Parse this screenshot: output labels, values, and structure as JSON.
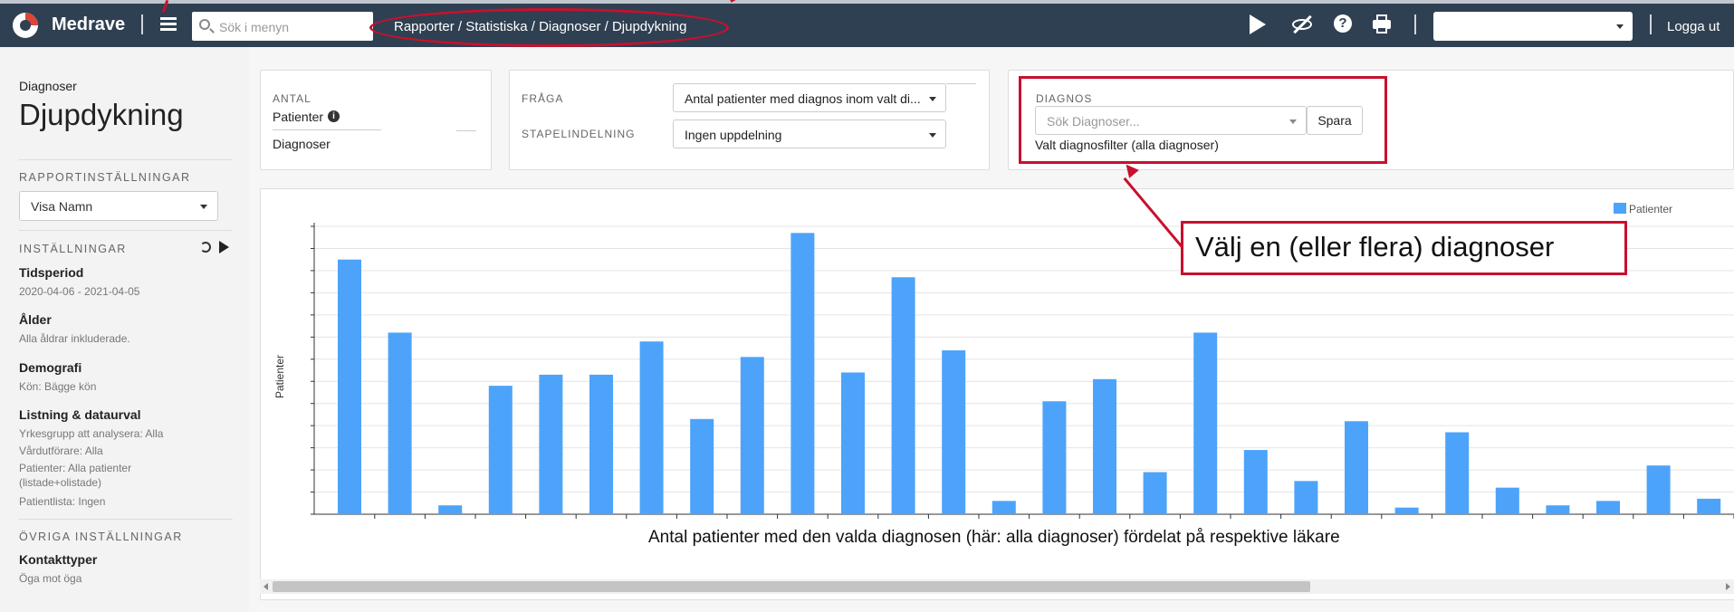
{
  "app": {
    "name": "Medrave"
  },
  "topbar": {
    "search_placeholder": "Sök i menyn",
    "breadcrumb": "Rapporter / Statistiska / Diagnoser / Djupdykning",
    "logout_label": "Logga ut",
    "user_select_value": "",
    "icons": [
      "play-icon",
      "eye-off-icon",
      "help-icon",
      "print-icon"
    ]
  },
  "sidebar": {
    "category": "Diagnoser",
    "title": "Djupdykning",
    "report_settings_heading": "RAPPORTINSTÄLLNINGAR",
    "display_select": "Visa Namn",
    "settings_heading": "INSTÄLLNINGAR",
    "settings": [
      {
        "label": "Tidsperiod",
        "lines": [
          "2020-04-06 - 2021-04-05"
        ]
      },
      {
        "label": "Ålder",
        "lines": [
          "Alla åldrar inkluderade."
        ]
      },
      {
        "label": "Demografi",
        "lines": [
          "Kön: Bägge kön"
        ]
      },
      {
        "label": "Listning & dataurval",
        "lines": [
          "Yrkesgrupp att analysera: Alla",
          "Vårdutförare: Alla",
          "Patienter: Alla patienter",
          "(listade+olistade)",
          "Patientlista: Ingen"
        ]
      }
    ],
    "other_heading": "ÖVRIGA INSTÄLLNINGAR",
    "other": [
      {
        "label": "Kontakttyper",
        "lines": [
          "Öga mot öga"
        ]
      }
    ]
  },
  "controls": {
    "count_label": "ANTAL",
    "count_options": [
      "Patienter",
      "Diagnoser"
    ],
    "question_label": "FRÅGA",
    "question_value": "Antal patienter med diagnos inom valt di...",
    "bar_split_label": "STAPELINDELNING",
    "bar_split_value": "Ingen uppdelning",
    "diagnosis_label": "DIAGNOS",
    "diagnosis_placeholder": "Sök Diagnoser...",
    "save_label": "Spara",
    "filter_text": "Valt diagnosfilter (alla diagnoser)"
  },
  "annotations": {
    "callout": "Välj en (eller flera) diagnoser",
    "caption": "Antal patienter med den valda diagnosen (här: alla diagnoser) fördelat på respektive läkare"
  },
  "colors": {
    "bar": "#4da3fa",
    "annotation": "#c8102e",
    "topbar": "#2f4052"
  },
  "chart_data": {
    "type": "bar",
    "ylabel": "Patienter",
    "series": [
      {
        "name": "Patienter",
        "values": [
          115,
          82,
          4,
          58,
          63,
          63,
          78,
          43,
          71,
          127,
          64,
          107,
          74,
          6,
          51,
          61,
          19,
          82,
          29,
          15,
          42,
          3,
          37,
          12,
          4,
          6,
          22,
          7
        ]
      }
    ],
    "ylim": [
      0,
      130
    ],
    "grid": true,
    "legend_position": "top-right"
  }
}
